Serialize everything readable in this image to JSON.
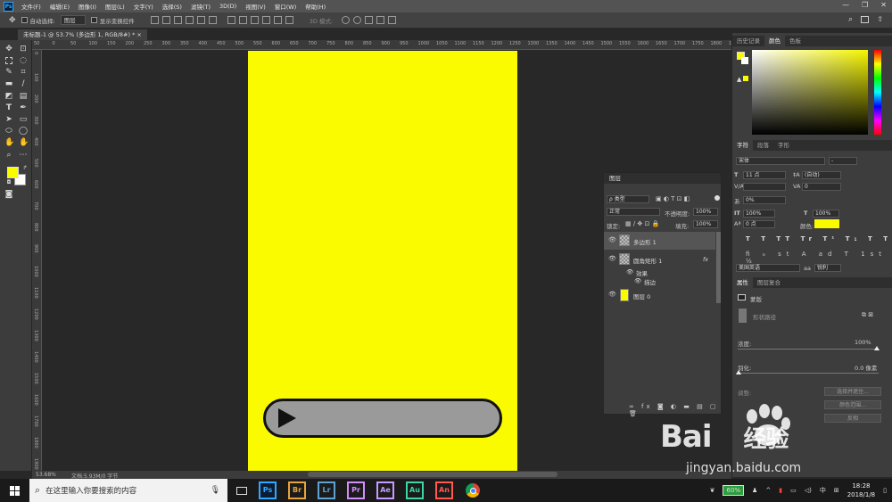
{
  "menu": {
    "items": [
      "文件(F)",
      "编辑(E)",
      "图像(I)",
      "图层(L)",
      "文字(Y)",
      "选择(S)",
      "滤镜(T)",
      "3D(D)",
      "视图(V)",
      "窗口(W)",
      "帮助(H)"
    ],
    "ps": "Ps"
  },
  "options": {
    "auto_select": "自动选择:",
    "layer_select": "图层",
    "show_transform": "显示变换控件",
    "mode3d": "3D 模式:"
  },
  "document": {
    "tab_title": "未标题-1 @ 53.7% (多边形 1, RGB/8#) *",
    "close": "×"
  },
  "ruler": {
    "top": [
      "50",
      "0",
      "50",
      "100",
      "150",
      "200",
      "250",
      "300",
      "350",
      "400",
      "450",
      "500",
      "550",
      "600",
      "650",
      "700",
      "750",
      "800",
      "850",
      "900",
      "950",
      "1000",
      "1050",
      "1100",
      "1150",
      "1200",
      "1250",
      "1300",
      "1350",
      "1400",
      "1450",
      "1500",
      "1550",
      "1600",
      "1650",
      "1700",
      "1750",
      "1800",
      "1850"
    ],
    "left": [
      "0",
      "100",
      "200",
      "300",
      "400",
      "500",
      "600",
      "700",
      "800",
      "900",
      "1000",
      "1100",
      "1200",
      "1300",
      "1400",
      "1500",
      "1600",
      "1700",
      "1800",
      "1900"
    ]
  },
  "status": {
    "zoom": "53.68%",
    "doc": "文档:5.93M/0 字节"
  },
  "canvas": {
    "fill": "#fbfb00",
    "pill_fill": "#9a9a9a"
  },
  "layers": {
    "title": "图层",
    "filter": "ρ 类型",
    "blend": "正常",
    "opacity_label": "不透明度:",
    "opacity": "100%",
    "lock_label": "锁定:",
    "fill_label": "填充:",
    "fill": "100%",
    "items": [
      {
        "name": "多边形 1"
      },
      {
        "name": "圆角矩形 1",
        "fx": "fx"
      },
      {
        "name": "效果"
      },
      {
        "name": "描边"
      },
      {
        "name": "图层 0"
      }
    ]
  },
  "right": {
    "tabs_top": [
      "历史记录",
      "颜色",
      "色板"
    ],
    "tabs_char": [
      "字符",
      "段落",
      "字形"
    ],
    "font": "宋体",
    "font_style": "-",
    "size": "11 点",
    "leading": "(自动)",
    "tracking": "0",
    "scale": "0%",
    "vscale": "100%",
    "hscale": "100%",
    "baseline": "0 点",
    "color_label": "颜色:",
    "lang": "美国英语",
    "aa": "锐利",
    "aa_label": "aa",
    "tabs_props": [
      "属性",
      "图层复合"
    ],
    "mask": "蒙版",
    "shape_path": "形状路径",
    "density_label": "浓度:",
    "density": "100%",
    "feather_label": "羽化:",
    "feather": "0.0 像素",
    "adjust_label": "调整:",
    "btn1": "选择并遮住...",
    "btn2": "颜色范围...",
    "btn3": "反相"
  },
  "taskbar": {
    "search": "在这里输入你要搜索的内容",
    "apps": [
      {
        "label": "Ps",
        "color": "#31a8ff"
      },
      {
        "label": "Br",
        "color": "#e8a33a"
      },
      {
        "label": "Lr",
        "color": "#5fa3d3"
      },
      {
        "label": "Pr",
        "color": "#d58cff"
      },
      {
        "label": "Ae",
        "color": "#c79bff"
      },
      {
        "label": "Au",
        "color": "#3ed6a3"
      },
      {
        "label": "An",
        "color": "#ff5a4d"
      }
    ],
    "battery": "60%",
    "ime": "中",
    "time": "18:28",
    "date": "2018/1/8"
  },
  "watermark": {
    "main": "Bai",
    "suffix": "经验",
    "sub": "jingyan.baidu.com"
  }
}
